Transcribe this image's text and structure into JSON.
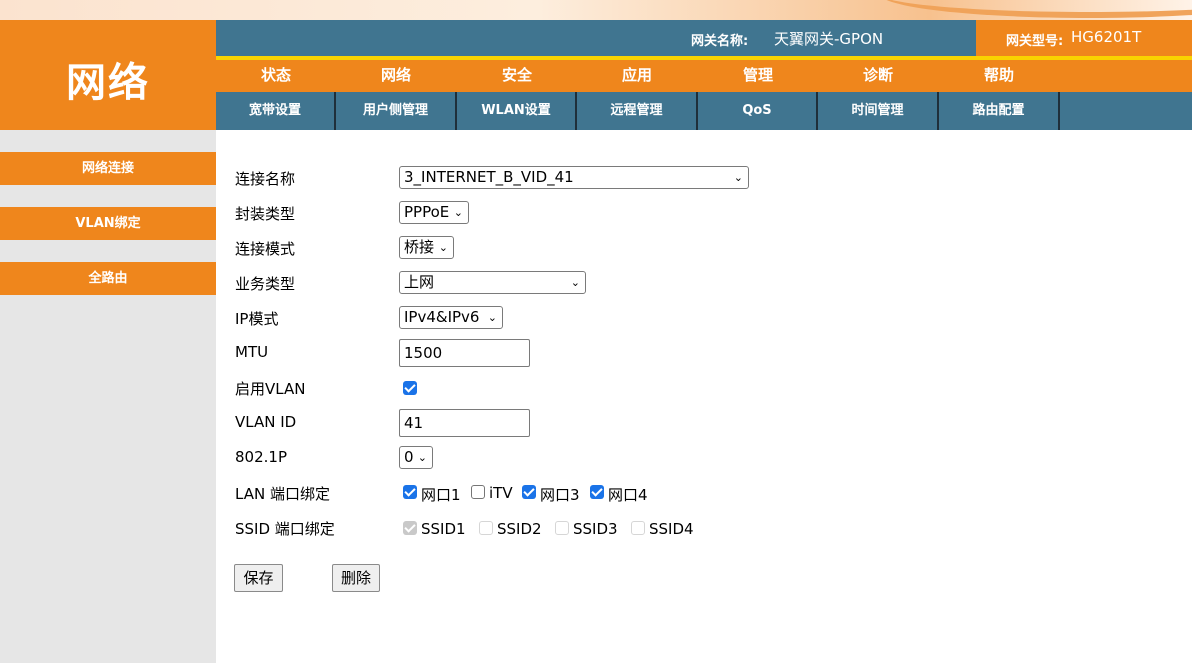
{
  "logo": {
    "title": "网络"
  },
  "header": {
    "gateway_name_label": "网关名称:",
    "gateway_name_value": "天翼网关-GPON",
    "gateway_model_label": "网关型号:",
    "gateway_model_value": "HG6201T"
  },
  "main_nav": [
    "状态",
    "网络",
    "安全",
    "应用",
    "管理",
    "诊断",
    "帮助"
  ],
  "sub_nav": [
    "宽带设置",
    "用户侧管理",
    "WLAN设置",
    "远程管理",
    "QoS",
    "时间管理",
    "路由配置"
  ],
  "sidebar": [
    "网络连接",
    "VLAN绑定",
    "全路由"
  ],
  "form": {
    "connection_name": {
      "label": "连接名称",
      "value": "3_INTERNET_B_VID_41"
    },
    "encapsulation": {
      "label": "封装类型",
      "value": "PPPoE"
    },
    "connection_mode": {
      "label": "连接模式",
      "value": "桥接"
    },
    "service_type": {
      "label": "业务类型",
      "value": "上网"
    },
    "ip_mode": {
      "label": "IP模式",
      "value": "IPv4&IPv6"
    },
    "mtu": {
      "label": "MTU",
      "value": "1500"
    },
    "enable_vlan": {
      "label": "启用VLAN",
      "checked": true
    },
    "vlan_id": {
      "label": "VLAN ID",
      "value": "41"
    },
    "priority_8021p": {
      "label": "802.1P",
      "value": "0"
    },
    "lan_binding": {
      "label": "LAN 端口绑定",
      "ports": [
        {
          "label": "网口1",
          "checked": true
        },
        {
          "label": "iTV",
          "checked": false
        },
        {
          "label": "网口3",
          "checked": true
        },
        {
          "label": "网口4",
          "checked": true
        }
      ]
    },
    "ssid_binding": {
      "label": "SSID 端口绑定",
      "ports": [
        {
          "label": "SSID1",
          "checked": true,
          "disabled": true
        },
        {
          "label": "SSID2",
          "checked": false,
          "disabled": true
        },
        {
          "label": "SSID3",
          "checked": false,
          "disabled": true
        },
        {
          "label": "SSID4",
          "checked": false,
          "disabled": true
        }
      ]
    }
  },
  "actions": {
    "save": "保存",
    "delete": "删除"
  },
  "colors": {
    "orange": "#ef861c",
    "steel_blue": "#407590",
    "yellow": "#f9d300",
    "checkbox_blue": "#1a73e8"
  }
}
